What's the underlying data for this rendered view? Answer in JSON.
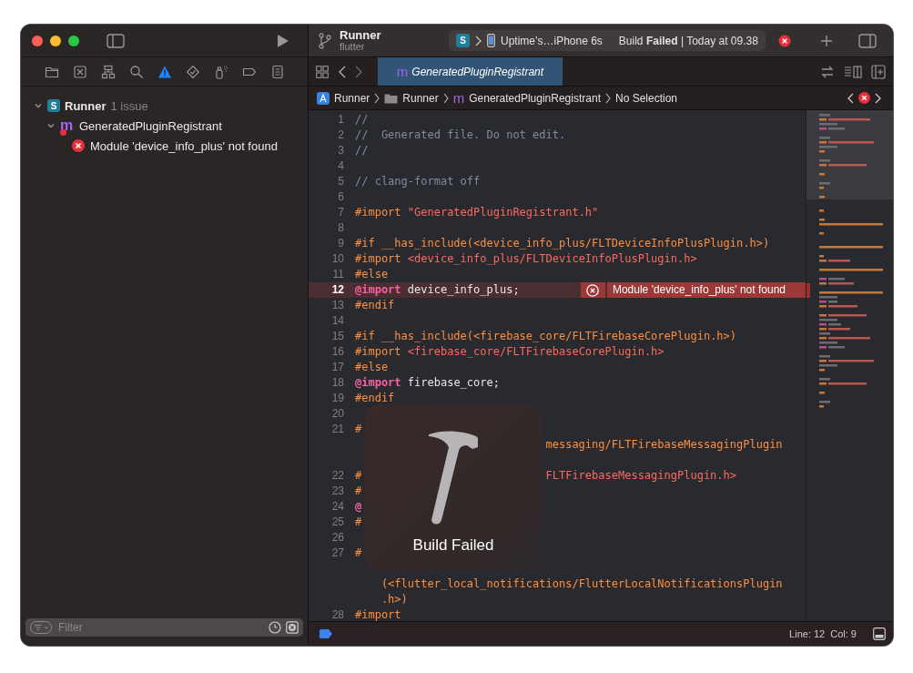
{
  "toolbar": {
    "project": "Runner",
    "branch": "flutter",
    "scheme_letter": "S",
    "destination": "Uptime’s…iPhone 6s",
    "status": "Build **Failed** | Today at 09.38"
  },
  "navigator_tabs": [
    {
      "kind": "folder",
      "selected": false
    },
    {
      "kind": "source-control",
      "selected": false
    },
    {
      "kind": "hierarchy",
      "selected": false
    },
    {
      "kind": "search",
      "selected": false
    },
    {
      "kind": "issue",
      "selected": true
    },
    {
      "kind": "test",
      "selected": false
    },
    {
      "kind": "debug",
      "selected": false
    },
    {
      "kind": "breakpoint",
      "selected": false
    },
    {
      "kind": "report",
      "selected": false
    }
  ],
  "issue_tree": [
    {
      "kind": "project",
      "letter": "S",
      "label": "Runner",
      "count": "1 issue",
      "expanded": true,
      "children": [
        {
          "kind": "file",
          "letter": "m",
          "label": "GeneratedPluginRegistrant",
          "expanded": true,
          "children": [
            {
              "kind": "error",
              "label": "Module 'device_info_plus' not found"
            }
          ]
        }
      ]
    }
  ],
  "filter": {
    "placeholder": "Filter"
  },
  "editor_tabs": [
    {
      "letter": "m",
      "label": "GeneratedPluginRegistrant",
      "selected": true
    }
  ],
  "jump_bar": [
    {
      "kind": "project",
      "label": "Runner"
    },
    {
      "kind": "folder",
      "label": "Runner"
    },
    {
      "kind": "file",
      "letter": "m",
      "label": "GeneratedPluginRegistrant"
    },
    {
      "kind": "none",
      "label": "No Selection"
    }
  ],
  "code_lines": [
    {
      "num": "1",
      "parts": [
        {
          "kind": "comment",
          "text": "//"
        }
      ]
    },
    {
      "num": "2",
      "parts": [
        {
          "kind": "comment",
          "text": "//  Generated file. Do not edit."
        }
      ]
    },
    {
      "num": "3",
      "parts": [
        {
          "kind": "comment",
          "text": "//"
        }
      ]
    },
    {
      "num": "4"
    },
    {
      "num": "5",
      "parts": [
        {
          "kind": "comment",
          "text": "// clang-format off"
        }
      ]
    },
    {
      "num": "6"
    },
    {
      "num": "7",
      "parts": [
        {
          "kind": "directive",
          "text": "#import "
        },
        {
          "kind": "string",
          "text": "\"GeneratedPluginRegistrant.h\""
        }
      ]
    },
    {
      "num": "8"
    },
    {
      "num": "9",
      "parts": [
        {
          "kind": "directive",
          "text": "#if __has_include(<device_info_plus/FLTDeviceInfoPlusPlugin.h>)"
        }
      ]
    },
    {
      "num": "10",
      "parts": [
        {
          "kind": "directive",
          "text": "#import "
        },
        {
          "kind": "string",
          "text": "<device_info_plus/FLTDeviceInfoPlusPlugin.h>"
        }
      ]
    },
    {
      "num": "11",
      "parts": [
        {
          "kind": "directive",
          "text": "#else"
        }
      ]
    },
    {
      "num": "12",
      "parts": [
        {
          "kind": "keyword",
          "text": "@import"
        },
        {
          "kind": "plain",
          "text": " device_info_plus;"
        }
      ],
      "error": "Module 'device_info_plus' not found"
    },
    {
      "num": "13",
      "parts": [
        {
          "kind": "directive",
          "text": "#endif"
        }
      ]
    },
    {
      "num": "14"
    },
    {
      "num": "15",
      "parts": [
        {
          "kind": "directive",
          "text": "#if __has_include(<firebase_core/FLTFirebaseCorePlugin.h>)"
        }
      ]
    },
    {
      "num": "16",
      "parts": [
        {
          "kind": "directive",
          "text": "#import "
        },
        {
          "kind": "string",
          "text": "<firebase_core/FLTFirebaseCorePlugin.h>"
        }
      ]
    },
    {
      "num": "17",
      "parts": [
        {
          "kind": "directive",
          "text": "#else"
        }
      ]
    },
    {
      "num": "18",
      "parts": [
        {
          "kind": "keyword",
          "text": "@import"
        },
        {
          "kind": "plain",
          "text": " firebase_core;"
        }
      ]
    },
    {
      "num": "19",
      "parts": [
        {
          "kind": "directive",
          "text": "#endif"
        }
      ]
    },
    {
      "num": "20"
    },
    {
      "num": "21",
      "rows": [
        {
          "parts": [
            {
              "kind": "directive",
              "text": "#"
            }
          ]
        },
        {
          "after_overlay": [
            {
              "kind": "directive",
              "text": "messaging/FLTFirebaseMessagingPlugin"
            }
          ]
        },
        {}
      ]
    },
    {
      "num": "22",
      "rows": [
        {
          "parts": [
            {
              "kind": "directive",
              "text": "#"
            }
          ],
          "after_overlay": [
            {
              "kind": "string",
              "text": "FLTFirebaseMessagingPlugin.h>"
            }
          ]
        }
      ]
    },
    {
      "num": "23",
      "parts": [
        {
          "kind": "directive",
          "text": "#"
        }
      ]
    },
    {
      "num": "24",
      "parts": [
        {
          "kind": "keyword",
          "text": "@"
        }
      ]
    },
    {
      "num": "25",
      "parts": [
        {
          "kind": "directive",
          "text": "#"
        }
      ]
    },
    {
      "num": "26"
    },
    {
      "num": "27",
      "rows": [
        {
          "parts": [
            {
              "kind": "directive",
              "text": "#"
            }
          ]
        },
        {},
        {
          "parts": [
            {
              "kind": "directive",
              "text": "(<flutter_local_notifications/FlutterLocalNotificationsPlugin"
            }
          ]
        },
        {
          "parts": [
            {
              "kind": "directive",
              "text": ".h>)"
            }
          ]
        }
      ]
    },
    {
      "num": "28",
      "parts": [
        {
          "kind": "directive",
          "text": "#import"
        }
      ]
    }
  ],
  "build_hud": {
    "label": "Build Failed"
  },
  "status_bar": {
    "line": "Line: 12",
    "col": "Col: 9"
  }
}
